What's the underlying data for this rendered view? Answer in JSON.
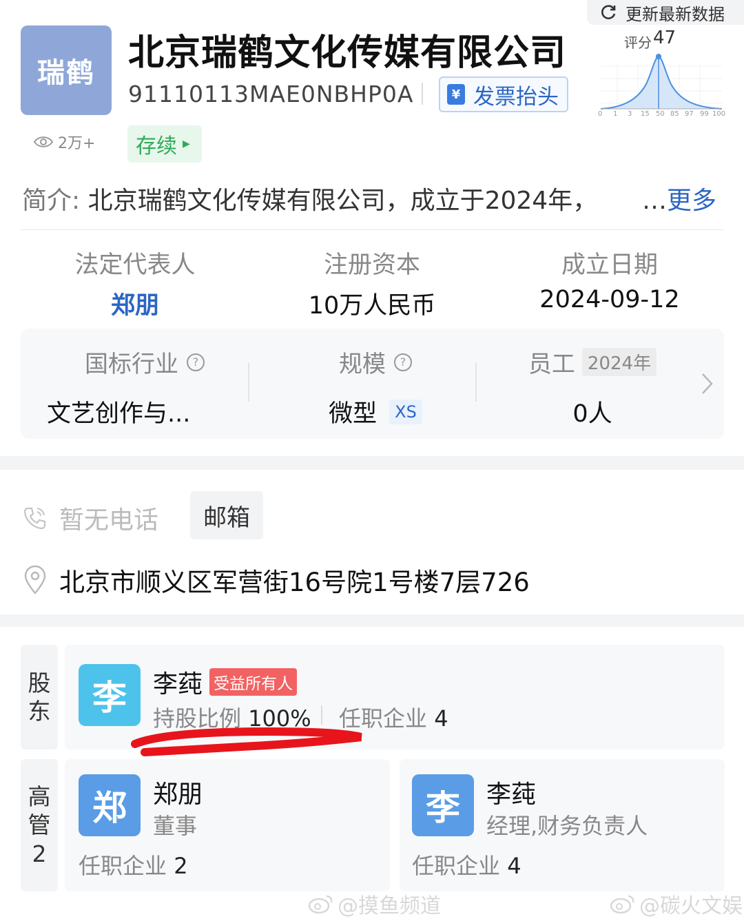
{
  "top": {
    "refresh_label": "更新最新数据"
  },
  "company": {
    "logo_text": "瑞鹤",
    "name": "北京瑞鹤文化传媒有限公司",
    "credit_code": "91110113MAE0NBHP0A",
    "invoice_label": "发票抬头",
    "invoice_icon_text": "¥",
    "views": "2万+",
    "status": "存续",
    "score_label": "评分",
    "score_value": "47",
    "score_ticks": [
      "0",
      "1",
      "3",
      "15",
      "50",
      "85",
      "97",
      "99",
      "100"
    ],
    "intro_label": "简介:",
    "intro_text": "北京瑞鹤文化传媒有限公司，成立于2024年，",
    "more_dots": "…",
    "more_label": "更多"
  },
  "basic_info": [
    {
      "key": "法定代表人",
      "value": "郑朋",
      "is_link": true
    },
    {
      "key": "注册资本",
      "value": "10万人民币",
      "is_link": false
    },
    {
      "key": "成立日期",
      "value": "2024-09-12",
      "is_link": false
    }
  ],
  "industry": {
    "industry_key": "国标行业",
    "industry_value": "文艺创作与...",
    "scale_key": "规模",
    "scale_value": "微型",
    "scale_tag": "XS",
    "staff_key": "员工",
    "staff_year": "2024年",
    "staff_value": "0人",
    "help_icon": "?"
  },
  "contact": {
    "phone": "暂无电话",
    "email_label": "邮箱",
    "address": "北京市顺义区军营街16号院1号楼7层726"
  },
  "shareholders": {
    "label_line1": "股",
    "label_line2": "东",
    "items": [
      {
        "avatar": "李",
        "name": "李莼",
        "tag": "受益所有人",
        "ratio_label": "持股比例",
        "ratio_value": "100%",
        "positions_label": "任职企业",
        "positions_value": "4"
      }
    ]
  },
  "executives": {
    "label_line1": "高",
    "label_line2": "管",
    "count": "2",
    "items": [
      {
        "avatar": "郑",
        "name": "郑朋",
        "role": "董事",
        "positions_label": "任职企业",
        "positions_value": "2"
      },
      {
        "avatar": "李",
        "name": "李莼",
        "role": "经理,财务负责人",
        "positions_label": "任职企业",
        "positions_value": "4"
      }
    ]
  },
  "watermarks": [
    "@摸鱼频道",
    "@碳火文娱"
  ],
  "colors": {
    "brand_blue": "#2b66c4",
    "status_green": "#2eab57",
    "tag_red": "#f26262",
    "logo_bg": "#8ea7d8",
    "annotation_red": "#e8141c"
  }
}
